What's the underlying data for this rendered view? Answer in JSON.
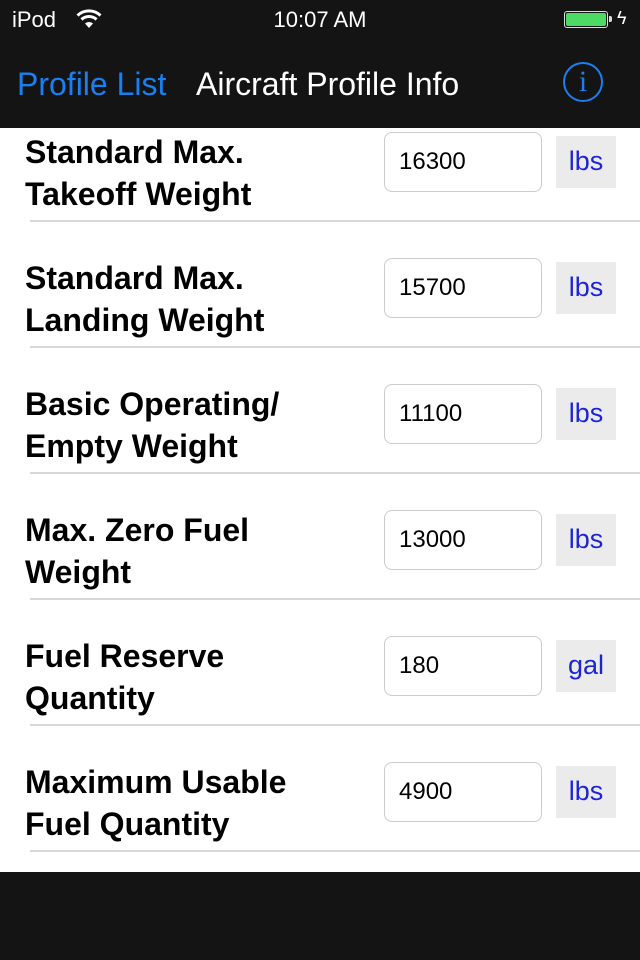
{
  "status_bar": {
    "carrier": "iPod",
    "time": "10:07 AM",
    "battery_level": 1.0,
    "charging": true
  },
  "nav": {
    "back_label": "Profile List",
    "title": "Aircraft Profile Info",
    "info_icon": "info-icon",
    "info_glyph": "i"
  },
  "rows": [
    {
      "label": "Standard Max. Takeoff Weight",
      "value": "16300",
      "unit": "lbs"
    },
    {
      "label": "Standard Max. Landing Weight",
      "value": "15700",
      "unit": "lbs"
    },
    {
      "label": "Basic Operating/ Empty Weight",
      "value": "11100",
      "unit": "lbs"
    },
    {
      "label": "Max. Zero Fuel Weight",
      "value": "13000",
      "unit": "lbs"
    },
    {
      "label": "Fuel Reserve Quantity",
      "value": "180",
      "unit": "gal"
    },
    {
      "label": "Maximum Usable Fuel Quantity",
      "value": "4900",
      "unit": "lbs"
    }
  ],
  "colors": {
    "accent": "#1a7ff0",
    "unit_text": "#1d24d4",
    "battery": "#4cd964"
  }
}
